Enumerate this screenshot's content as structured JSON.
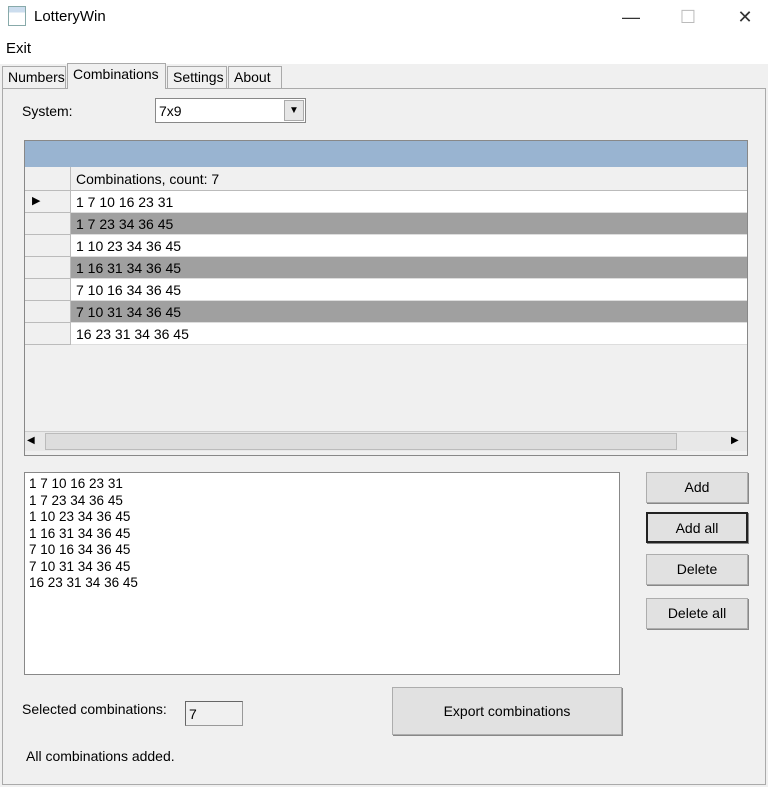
{
  "window": {
    "title": "LotteryWin",
    "minimize": "—",
    "maximize": "☐",
    "close": "✕"
  },
  "menu": {
    "exit": "Exit"
  },
  "tabs": [
    "Numbers",
    "Combinations",
    "Settings",
    "About"
  ],
  "system": {
    "label": "System:",
    "value": "7x9"
  },
  "grid": {
    "column_header": "Combinations, count: 7",
    "rows": [
      "1 7 10 16 23 31",
      "1 7 23 34 36 45",
      "1 10 23 34 36 45",
      "1 16 31 34 36 45",
      "7 10 16 34 36 45",
      "7 10 31 34 36 45",
      "16 23 31 34 36 45"
    ]
  },
  "list": {
    "items": [
      "1 7 10 16 23 31",
      "1 7 23 34 36 45",
      "1 10 23 34 36 45",
      "1 16 31 34 36 45",
      "7 10 16 34 36 45",
      "7 10 31 34 36 45",
      "16 23 31 34 36 45"
    ]
  },
  "buttons": {
    "add": "Add",
    "add_all": "Add all",
    "delete": "Delete",
    "delete_all": "Delete all",
    "export": "Export combinations"
  },
  "selected": {
    "label": "Selected combinations:",
    "value": "7"
  },
  "status": "All combinations added."
}
